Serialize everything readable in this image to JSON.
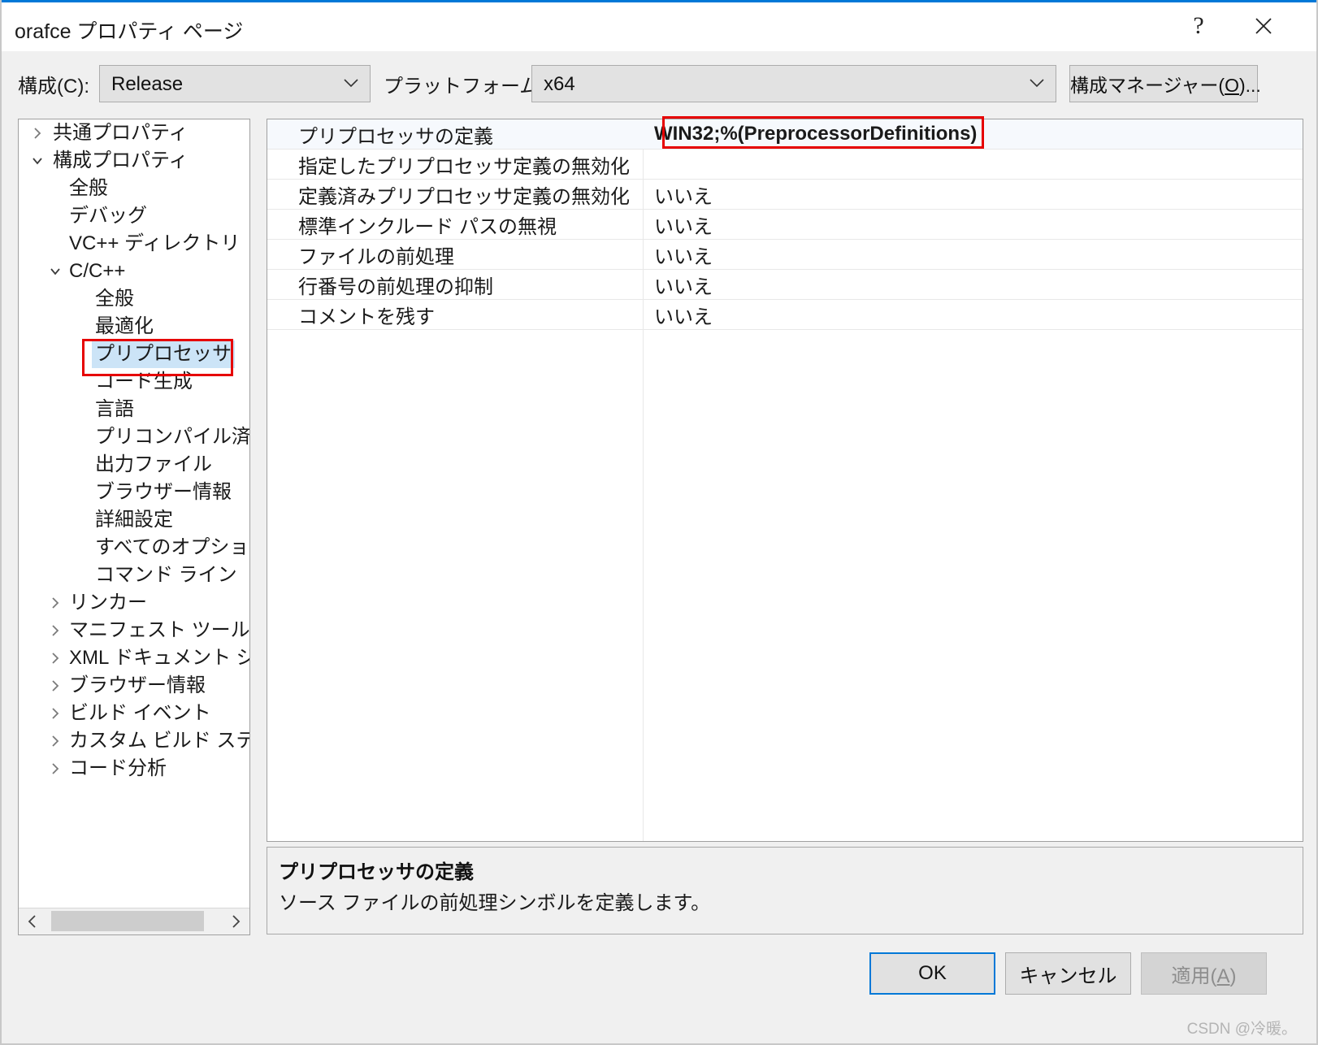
{
  "window": {
    "title": "orafce プロパティ ページ",
    "help_icon": "?",
    "close_icon": "×"
  },
  "toolbar": {
    "configuration_label": "構成(C):",
    "configuration_value": "Release",
    "platform_label": "プラットフォーム(P):",
    "platform_value": "x64",
    "config_manager_label_prefix": "構成マネージャー(",
    "config_manager_accel": "O",
    "config_manager_label_suffix": ")..."
  },
  "tree": {
    "items": [
      {
        "label": "共通プロパティ",
        "level": 0,
        "twisty": "collapsed",
        "selected": false
      },
      {
        "label": "構成プロパティ",
        "level": 0,
        "twisty": "expanded",
        "selected": false
      },
      {
        "label": "全般",
        "level": 1,
        "twisty": "none",
        "selected": false
      },
      {
        "label": "デバッグ",
        "level": 1,
        "twisty": "none",
        "selected": false
      },
      {
        "label": "VC++ ディレクトリ",
        "level": 1,
        "twisty": "none",
        "selected": false
      },
      {
        "label": "C/C++",
        "level": 1,
        "twisty": "expanded",
        "selected": false
      },
      {
        "label": "全般",
        "level": 2,
        "twisty": "none",
        "selected": false
      },
      {
        "label": "最適化",
        "level": 2,
        "twisty": "none",
        "selected": false
      },
      {
        "label": "プリプロセッサ",
        "level": 2,
        "twisty": "none",
        "selected": true
      },
      {
        "label": "コード生成",
        "level": 2,
        "twisty": "none",
        "selected": false
      },
      {
        "label": "言語",
        "level": 2,
        "twisty": "none",
        "selected": false
      },
      {
        "label": "プリコンパイル済みヘ",
        "level": 2,
        "twisty": "none",
        "selected": false
      },
      {
        "label": "出力ファイル",
        "level": 2,
        "twisty": "none",
        "selected": false
      },
      {
        "label": "ブラウザー情報",
        "level": 2,
        "twisty": "none",
        "selected": false
      },
      {
        "label": "詳細設定",
        "level": 2,
        "twisty": "none",
        "selected": false
      },
      {
        "label": "すべてのオプション",
        "level": 2,
        "twisty": "none",
        "selected": false
      },
      {
        "label": "コマンド ライン",
        "level": 2,
        "twisty": "none",
        "selected": false
      },
      {
        "label": "リンカー",
        "level": 1,
        "twisty": "collapsed",
        "selected": false
      },
      {
        "label": "マニフェスト ツール",
        "level": 1,
        "twisty": "collapsed",
        "selected": false
      },
      {
        "label": "XML ドキュメント ジェネl",
        "level": 1,
        "twisty": "collapsed",
        "selected": false
      },
      {
        "label": "ブラウザー情報",
        "level": 1,
        "twisty": "collapsed",
        "selected": false
      },
      {
        "label": "ビルド イベント",
        "level": 1,
        "twisty": "collapsed",
        "selected": false
      },
      {
        "label": "カスタム ビルド ステップ",
        "level": 1,
        "twisty": "collapsed",
        "selected": false
      },
      {
        "label": "コード分析",
        "level": 1,
        "twisty": "collapsed",
        "selected": false
      }
    ]
  },
  "properties": {
    "rows": [
      {
        "name": "プリプロセッサの定義",
        "value": "WIN32;%(PreprocessorDefinitions)"
      },
      {
        "name": "指定したプリプロセッサ定義の無効化",
        "value": ""
      },
      {
        "name": "定義済みプリプロセッサ定義の無効化",
        "value": "いいえ"
      },
      {
        "name": "標準インクルード パスの無視",
        "value": "いいえ"
      },
      {
        "name": "ファイルの前処理",
        "value": "いいえ"
      },
      {
        "name": "行番号の前処理の抑制",
        "value": "いいえ"
      },
      {
        "name": "コメントを残す",
        "value": "いいえ"
      }
    ]
  },
  "description": {
    "title": "プリプロセッサの定義",
    "body": "ソース ファイルの前処理シンボルを定義します。"
  },
  "footer": {
    "ok_label": "OK",
    "cancel_label": "キャンセル",
    "apply_label_prefix": "適用(",
    "apply_accel": "A",
    "apply_label_suffix": ")"
  },
  "watermark": "CSDN @冷暖。",
  "colors": {
    "accent": "#0078d7",
    "selection": "#cce4f7",
    "annotation": "#e60000",
    "dialog_bg": "#f0f0f0"
  }
}
